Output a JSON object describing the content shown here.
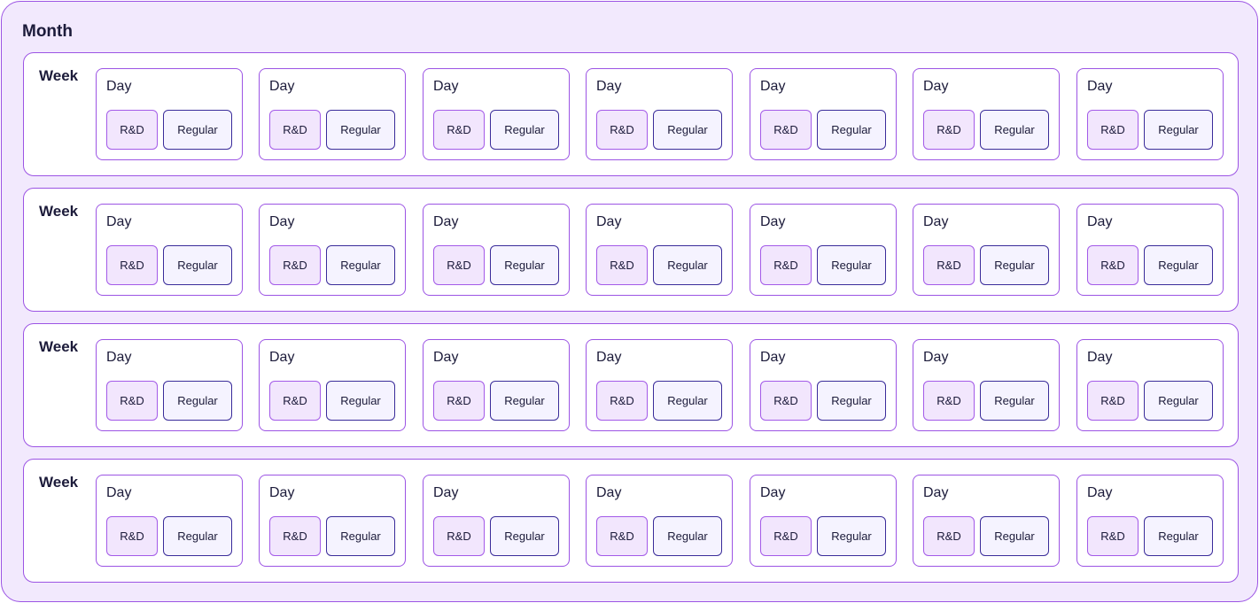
{
  "month": {
    "title": "Month",
    "weeks": [
      {
        "title": "Week",
        "days": [
          {
            "title": "Day",
            "chips": [
              "R&D",
              "Regular"
            ]
          },
          {
            "title": "Day",
            "chips": [
              "R&D",
              "Regular"
            ]
          },
          {
            "title": "Day",
            "chips": [
              "R&D",
              "Regular"
            ]
          },
          {
            "title": "Day",
            "chips": [
              "R&D",
              "Regular"
            ]
          },
          {
            "title": "Day",
            "chips": [
              "R&D",
              "Regular"
            ]
          },
          {
            "title": "Day",
            "chips": [
              "R&D",
              "Regular"
            ]
          },
          {
            "title": "Day",
            "chips": [
              "R&D",
              "Regular"
            ]
          }
        ]
      },
      {
        "title": "Week",
        "days": [
          {
            "title": "Day",
            "chips": [
              "R&D",
              "Regular"
            ]
          },
          {
            "title": "Day",
            "chips": [
              "R&D",
              "Regular"
            ]
          },
          {
            "title": "Day",
            "chips": [
              "R&D",
              "Regular"
            ]
          },
          {
            "title": "Day",
            "chips": [
              "R&D",
              "Regular"
            ]
          },
          {
            "title": "Day",
            "chips": [
              "R&D",
              "Regular"
            ]
          },
          {
            "title": "Day",
            "chips": [
              "R&D",
              "Regular"
            ]
          },
          {
            "title": "Day",
            "chips": [
              "R&D",
              "Regular"
            ]
          }
        ]
      },
      {
        "title": "Week",
        "days": [
          {
            "title": "Day",
            "chips": [
              "R&D",
              "Regular"
            ]
          },
          {
            "title": "Day",
            "chips": [
              "R&D",
              "Regular"
            ]
          },
          {
            "title": "Day",
            "chips": [
              "R&D",
              "Regular"
            ]
          },
          {
            "title": "Day",
            "chips": [
              "R&D",
              "Regular"
            ]
          },
          {
            "title": "Day",
            "chips": [
              "R&D",
              "Regular"
            ]
          },
          {
            "title": "Day",
            "chips": [
              "R&D",
              "Regular"
            ]
          },
          {
            "title": "Day",
            "chips": [
              "R&D",
              "Regular"
            ]
          }
        ]
      },
      {
        "title": "Week",
        "days": [
          {
            "title": "Day",
            "chips": [
              "R&D",
              "Regular"
            ]
          },
          {
            "title": "Day",
            "chips": [
              "R&D",
              "Regular"
            ]
          },
          {
            "title": "Day",
            "chips": [
              "R&D",
              "Regular"
            ]
          },
          {
            "title": "Day",
            "chips": [
              "R&D",
              "Regular"
            ]
          },
          {
            "title": "Day",
            "chips": [
              "R&D",
              "Regular"
            ]
          },
          {
            "title": "Day",
            "chips": [
              "R&D",
              "Regular"
            ]
          },
          {
            "title": "Day",
            "chips": [
              "R&D",
              "Regular"
            ]
          }
        ]
      }
    ]
  },
  "colors": {
    "month_background": "#f2e9fd",
    "border_purple": "#9c54e4",
    "rd_chip_background": "#f2e6fd",
    "regular_chip_border": "#3a2c9a",
    "text": "#1c1b3a"
  }
}
